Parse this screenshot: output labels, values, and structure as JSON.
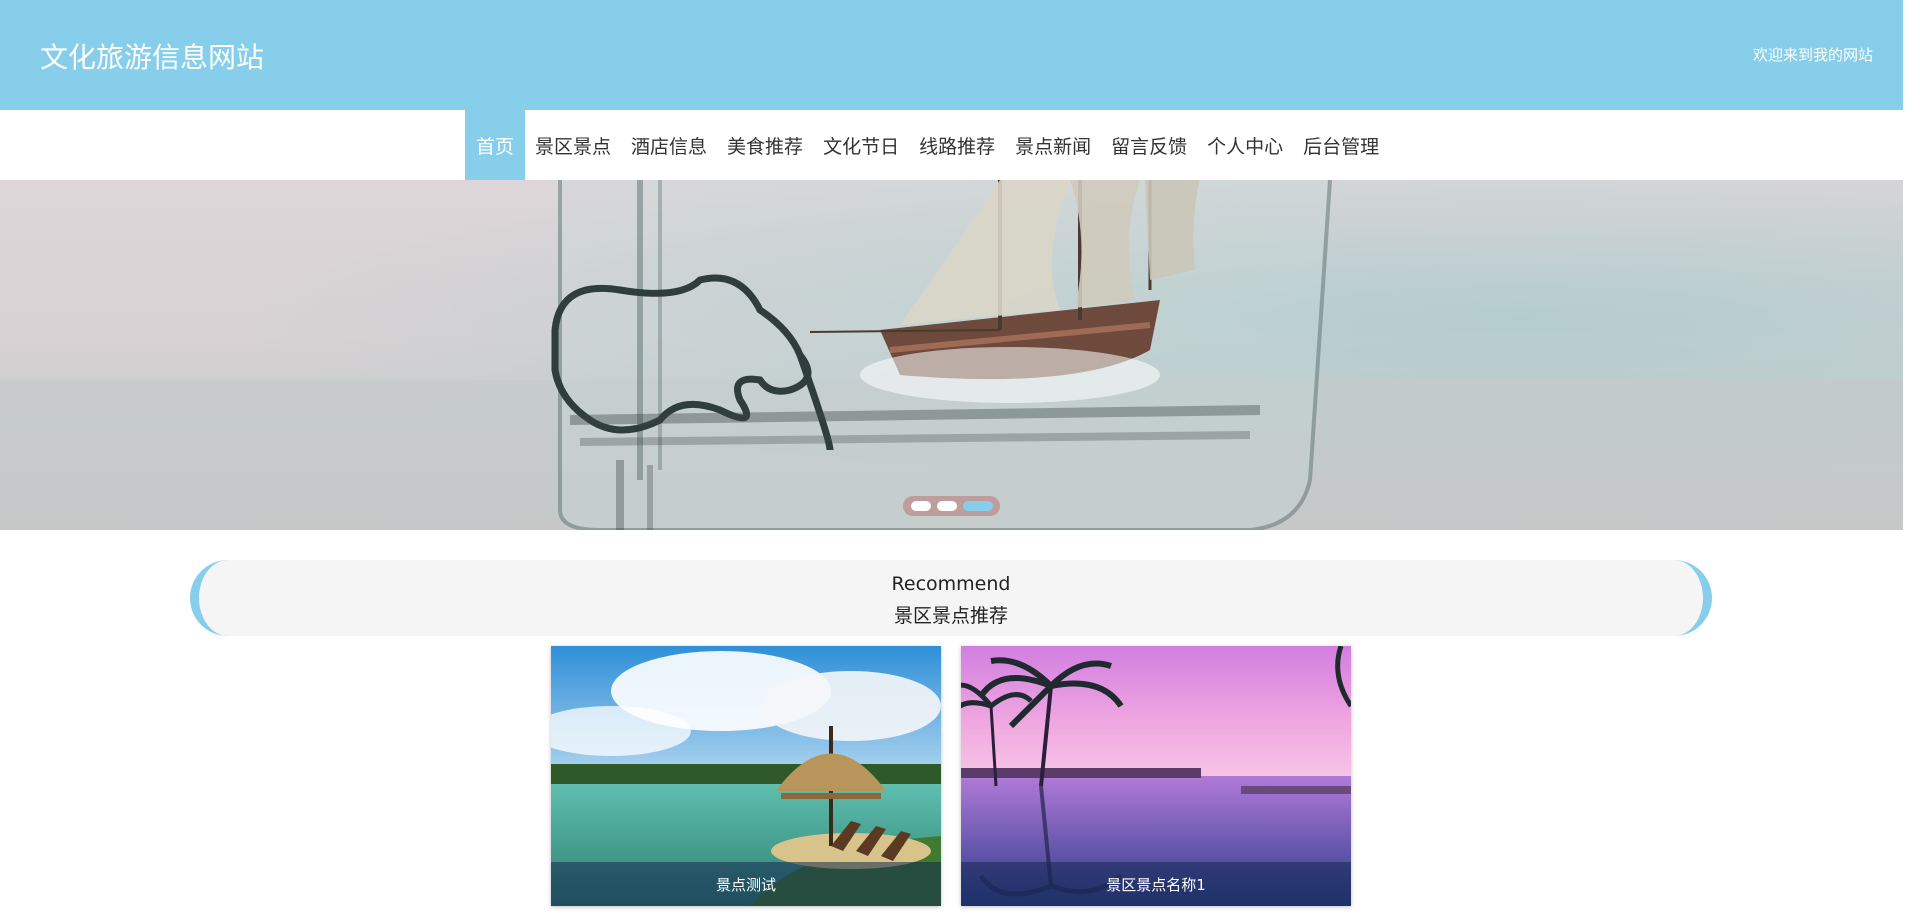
{
  "header": {
    "site_title": "文化旅游信息网站",
    "welcome": "欢迎来到我的网站"
  },
  "nav": {
    "items": [
      {
        "label": "首页",
        "active": true
      },
      {
        "label": "景区景点",
        "active": false
      },
      {
        "label": "酒店信息",
        "active": false
      },
      {
        "label": "美食推荐",
        "active": false
      },
      {
        "label": "文化节日",
        "active": false
      },
      {
        "label": "线路推荐",
        "active": false
      },
      {
        "label": "景点新闻",
        "active": false
      },
      {
        "label": "留言反馈",
        "active": false
      },
      {
        "label": "个人中心",
        "active": false
      },
      {
        "label": "后台管理",
        "active": false
      }
    ]
  },
  "carousel": {
    "slide_count": 3,
    "active_index": 2
  },
  "recommend": {
    "title_en": "Recommend",
    "title_cn": "景区景点推荐",
    "cards": [
      {
        "caption": "景点测试"
      },
      {
        "caption": "景区景点名称1"
      }
    ]
  },
  "colors": {
    "accent": "#87ceeb",
    "section_bg": "#f5f5f5"
  }
}
